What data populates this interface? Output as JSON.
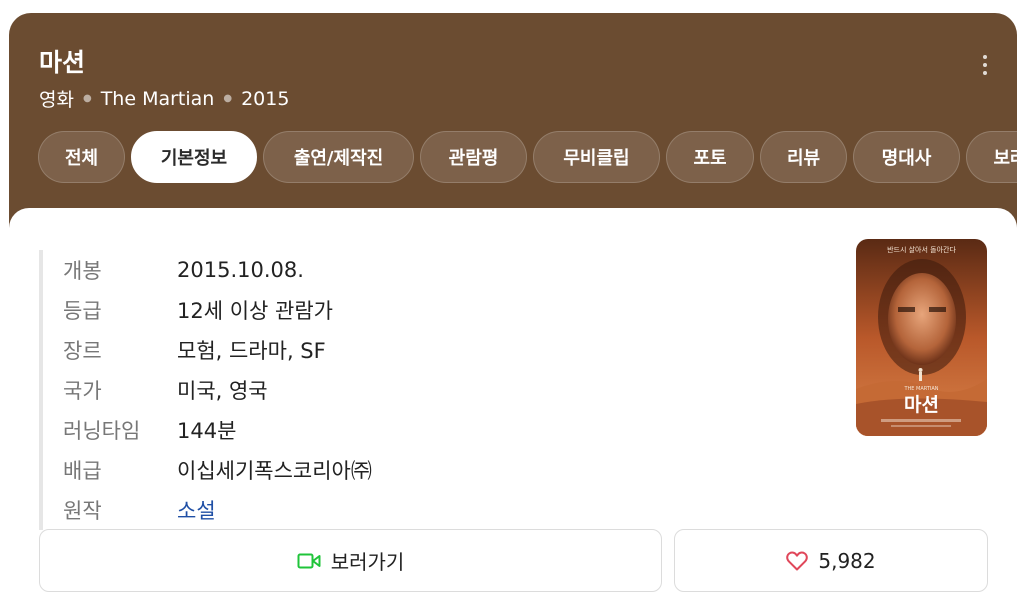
{
  "header": {
    "title": "마션",
    "meta": [
      "영화",
      "The Martian",
      "2015"
    ]
  },
  "tabs": [
    {
      "label": "전체",
      "active": false
    },
    {
      "label": "기본정보",
      "active": true
    },
    {
      "label": "출연/제작진",
      "active": false
    },
    {
      "label": "관람평",
      "active": false
    },
    {
      "label": "무비클립",
      "active": false
    },
    {
      "label": "포토",
      "active": false
    },
    {
      "label": "리뷰",
      "active": false
    },
    {
      "label": "명대사",
      "active": false
    },
    {
      "label": "보러",
      "active": false
    }
  ],
  "info": [
    {
      "label": "개봉",
      "value": "2015.10.08."
    },
    {
      "label": "등급",
      "value": "12세 이상 관람가"
    },
    {
      "label": "장르",
      "value": "모험, 드라마, SF"
    },
    {
      "label": "국가",
      "value": "미국, 영국"
    },
    {
      "label": "러닝타임",
      "value": "144분"
    },
    {
      "label": "배급",
      "value": "이십세기폭스코리아㈜"
    },
    {
      "label": "원작",
      "value": "소설"
    }
  ],
  "poster": {
    "title": "마션",
    "tagline": "반드시 살아서 돌아간다",
    "subtitle": "THE MARTIAN"
  },
  "actions": {
    "watch_label": "보러가기",
    "like_count": "5,982"
  },
  "colors": {
    "header_bg": "#6b4c31",
    "link": "#1f4fa5",
    "watch_icon": "#1fc43a",
    "heart_icon": "#e0475a"
  }
}
